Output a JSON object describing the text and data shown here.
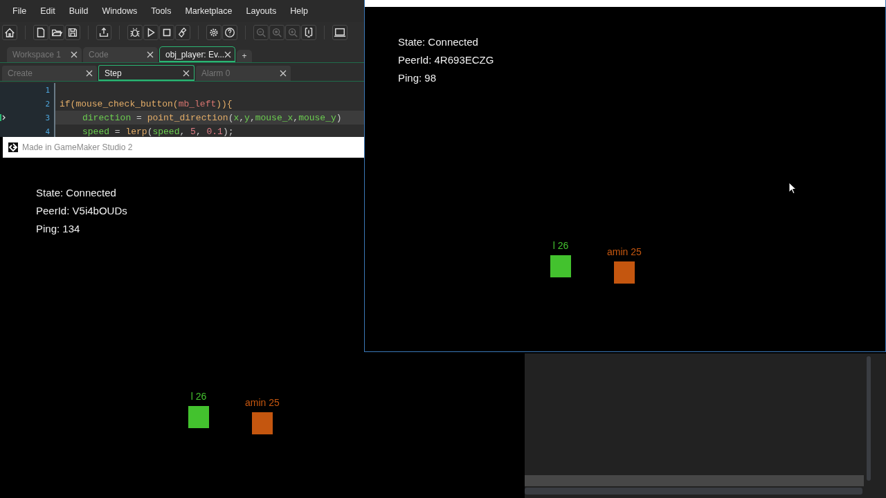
{
  "ide": {
    "menu": [
      "File",
      "Edit",
      "Build",
      "Windows",
      "Tools",
      "Marketplace",
      "Layouts",
      "Help"
    ],
    "toolbar": [
      {
        "kind": "home",
        "disabled": false
      },
      {
        "kind": "sep"
      },
      {
        "kind": "new",
        "disabled": false
      },
      {
        "kind": "open",
        "disabled": false
      },
      {
        "kind": "save",
        "disabled": false
      },
      {
        "kind": "sep"
      },
      {
        "kind": "export",
        "disabled": false
      },
      {
        "kind": "sep"
      },
      {
        "kind": "debug",
        "disabled": false
      },
      {
        "kind": "run",
        "disabled": false
      },
      {
        "kind": "stop",
        "disabled": false
      },
      {
        "kind": "clean",
        "disabled": false
      },
      {
        "kind": "sep"
      },
      {
        "kind": "settings",
        "disabled": false
      },
      {
        "kind": "help",
        "disabled": false
      },
      {
        "kind": "sep"
      },
      {
        "kind": "zoom-out",
        "disabled": true
      },
      {
        "kind": "zoom-reset",
        "disabled": true
      },
      {
        "kind": "zoom-in",
        "disabled": true
      },
      {
        "kind": "fit",
        "disabled": false
      },
      {
        "kind": "sep"
      },
      {
        "kind": "monitor",
        "disabled": false
      }
    ],
    "tabs": [
      {
        "label": "Workspace 1",
        "selected": false
      },
      {
        "label": "Code",
        "selected": false
      },
      {
        "label": "obj_player: Ev...",
        "selected": true
      }
    ],
    "new_tab": "+",
    "event_tabs": [
      {
        "label": "Create",
        "selected": false
      },
      {
        "label": "Step",
        "selected": true
      },
      {
        "label": "Alarm 0",
        "selected": false
      }
    ],
    "code": [
      {
        "number": "1",
        "current": false
      },
      {
        "number": "2",
        "current": false,
        "indented": false,
        "tokens": [
          {
            "kind": "fn",
            "text": "if("
          },
          {
            "kind": "fn",
            "text": "mouse_check_button"
          },
          {
            "kind": "fn",
            "text": "("
          },
          {
            "kind": "const",
            "text": "mb_left"
          },
          {
            "kind": "fn",
            "text": ")){"
          }
        ]
      },
      {
        "number": "3",
        "current": true,
        "indented": true,
        "tokens": [
          {
            "kind": "var",
            "text": "direction"
          },
          {
            "kind": "punct",
            "text": " = "
          },
          {
            "kind": "fn",
            "text": "point_direction"
          },
          {
            "kind": "punct",
            "text": "("
          },
          {
            "kind": "var",
            "text": "x"
          },
          {
            "kind": "punct",
            "text": ","
          },
          {
            "kind": "var",
            "text": "y"
          },
          {
            "kind": "punct",
            "text": ","
          },
          {
            "kind": "var",
            "text": "mouse_x"
          },
          {
            "kind": "punct",
            "text": ","
          },
          {
            "kind": "var",
            "text": "mouse_y"
          },
          {
            "kind": "punct",
            "text": ")"
          }
        ]
      },
      {
        "number": "4",
        "current": false,
        "indented": true,
        "tokens": [
          {
            "kind": "var",
            "text": "speed"
          },
          {
            "kind": "punct",
            "text": " = "
          },
          {
            "kind": "fn",
            "text": "lerp"
          },
          {
            "kind": "punct",
            "text": "("
          },
          {
            "kind": "var",
            "text": "speed"
          },
          {
            "kind": "punct",
            "text": ", "
          },
          {
            "kind": "num",
            "text": "5"
          },
          {
            "kind": "punct",
            "text": ", "
          },
          {
            "kind": "num",
            "text": "0.1"
          },
          {
            "kind": "punct",
            "text": ");"
          }
        ]
      }
    ]
  },
  "game_windows": [
    {
      "title": "Made in GameMaker Studio 2",
      "status": [
        "State: Connected",
        "PeerId: V5i4bOUDs",
        "Ping: 134"
      ],
      "players": [
        {
          "name": "l 26",
          "color": "#43c22e"
        },
        {
          "name": "amin 25",
          "color": "#c4560f"
        }
      ]
    },
    {
      "status": [
        "State: Connected",
        "PeerId: 4R693ECZG",
        "Ping: 98"
      ],
      "players": [
        {
          "name": "l 26",
          "color": "#43c22e"
        },
        {
          "name": "amin 25",
          "color": "#c4560f"
        }
      ]
    }
  ]
}
